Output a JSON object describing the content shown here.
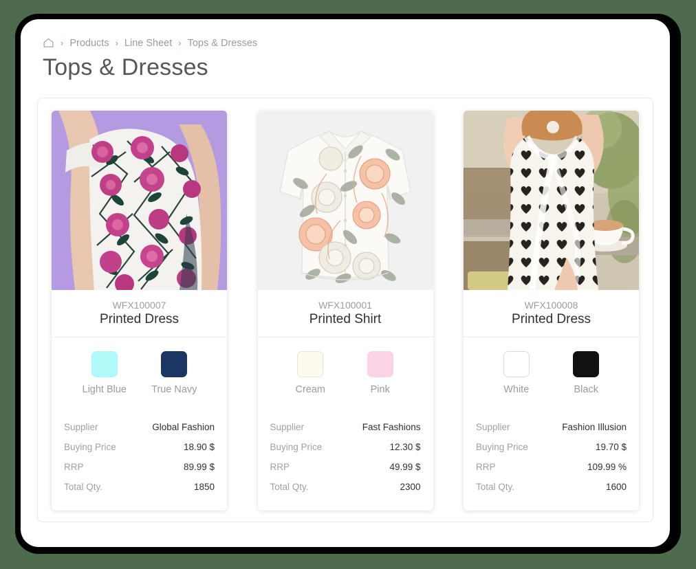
{
  "breadcrumb": {
    "home_icon": "home-icon",
    "separator": "›",
    "items": [
      "Products",
      "Line Sheet",
      "Tops & Dresses"
    ]
  },
  "page_title": "Tops & Dresses",
  "detail_labels": {
    "supplier": "Supplier",
    "buying_price": "Buying Price",
    "rrp": "RRP",
    "total_qty": "Total Qty."
  },
  "theme": {
    "background": "#4e6b4d",
    "frame": "#000000",
    "page": "#ffffff",
    "accent": "#5dade2",
    "muted_text": "#9b9ba3",
    "dark_text": "#2f3034"
  },
  "cards": [
    {
      "sku": "WFX100007",
      "name": "Printed Dress",
      "image_kind": "floral-dress-purple-backdrop",
      "image_bg": "#b49ae0",
      "colors": [
        {
          "label": "Light Blue",
          "hex": "#affaf8",
          "border": false
        },
        {
          "label": "True Navy",
          "hex": "#1c3664",
          "border": false
        }
      ],
      "details": {
        "supplier": "Global Fashion",
        "buying_price": "18.90 $",
        "rrp": "89.99 $",
        "total_qty": "1850"
      }
    },
    {
      "sku": "WFX100001",
      "name": "Printed Shirt",
      "image_kind": "floral-shirt-flatlay",
      "image_bg": "#f1f1f1",
      "colors": [
        {
          "label": "Cream",
          "hex": "#fdfaf0",
          "border": true
        },
        {
          "label": "Pink",
          "hex": "#fad3e7",
          "border": false
        }
      ],
      "details": {
        "supplier": "Fast Fashions",
        "buying_price": "12.30 $",
        "rrp": "49.99 $",
        "total_qty": "2300"
      }
    },
    {
      "sku": "WFX100008",
      "name": "Printed Dress",
      "image_kind": "heart-print-dress-cafe",
      "image_bg": "#c8c0ac",
      "colors": [
        {
          "label": "White",
          "hex": "#ffffff",
          "border": true
        },
        {
          "label": "Black",
          "hex": "#111111",
          "border": false
        }
      ],
      "details": {
        "supplier": "Fashion Illusion",
        "buying_price": "19.70 $",
        "rrp": "109.99 %",
        "total_qty": "1600"
      }
    }
  ]
}
